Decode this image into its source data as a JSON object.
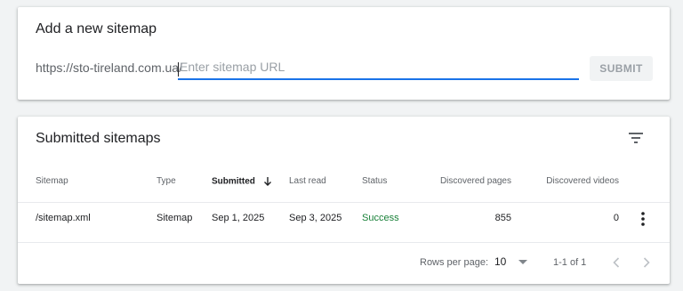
{
  "add_sitemap": {
    "title": "Add a new sitemap",
    "url_prefix": "https://sto-tireland.com.ua/",
    "input_value": "",
    "input_placeholder": "Enter sitemap URL",
    "submit_label": "SUBMIT"
  },
  "submitted": {
    "title": "Submitted sitemaps",
    "columns": {
      "sitemap": "Sitemap",
      "type": "Type",
      "submitted": "Submitted",
      "last_read": "Last read",
      "status": "Status",
      "discovered_pages": "Discovered pages",
      "discovered_videos": "Discovered videos"
    },
    "rows": [
      {
        "sitemap": "/sitemap.xml",
        "type": "Sitemap",
        "submitted": "Sep 1, 2025",
        "last_read": "Sep 3, 2025",
        "status": "Success",
        "discovered_pages": "855",
        "discovered_videos": "0"
      }
    ],
    "footer": {
      "rows_per_page_label": "Rows per page:",
      "rows_per_page_value": "10",
      "range_label": "1-1 of 1"
    }
  },
  "colors": {
    "accent": "#1a73e8",
    "success": "#188038",
    "background": "#f1f3f4"
  },
  "icons": {
    "filter": "filter-icon",
    "sort": "arrow-down-icon",
    "more": "more-vert-icon",
    "prev": "chevron-left-icon",
    "next": "chevron-right-icon"
  }
}
